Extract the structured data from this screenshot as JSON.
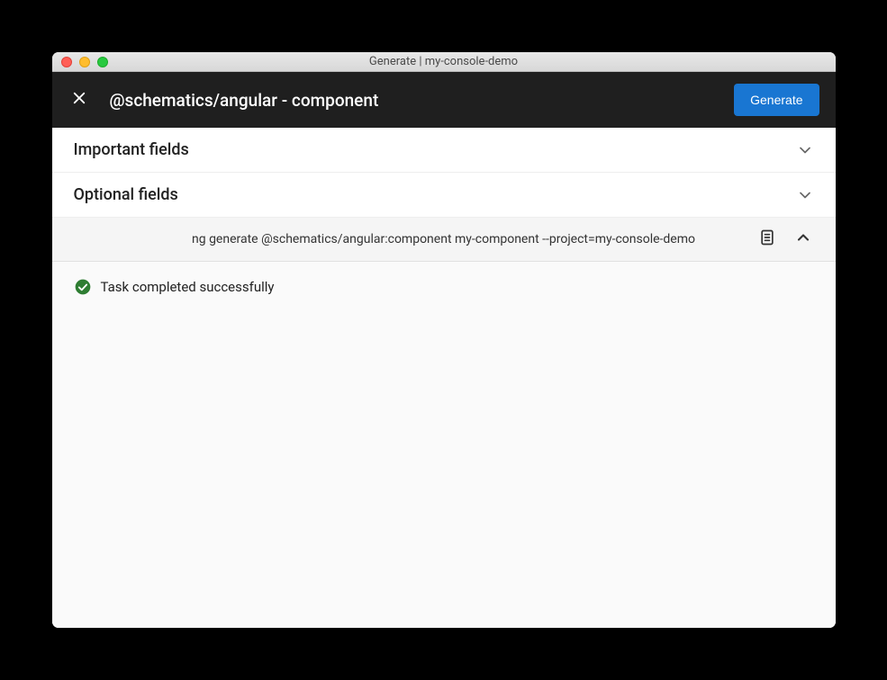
{
  "window": {
    "title": "Generate | my-console-demo"
  },
  "header": {
    "title": "@schematics/angular - component",
    "generate_label": "Generate"
  },
  "sections": {
    "important_label": "Important fields",
    "optional_label": "Optional fields"
  },
  "command": {
    "text": "ng generate @schematics/angular:component my-component --project=my-console-demo"
  },
  "status": {
    "message": "Task completed successfully"
  }
}
